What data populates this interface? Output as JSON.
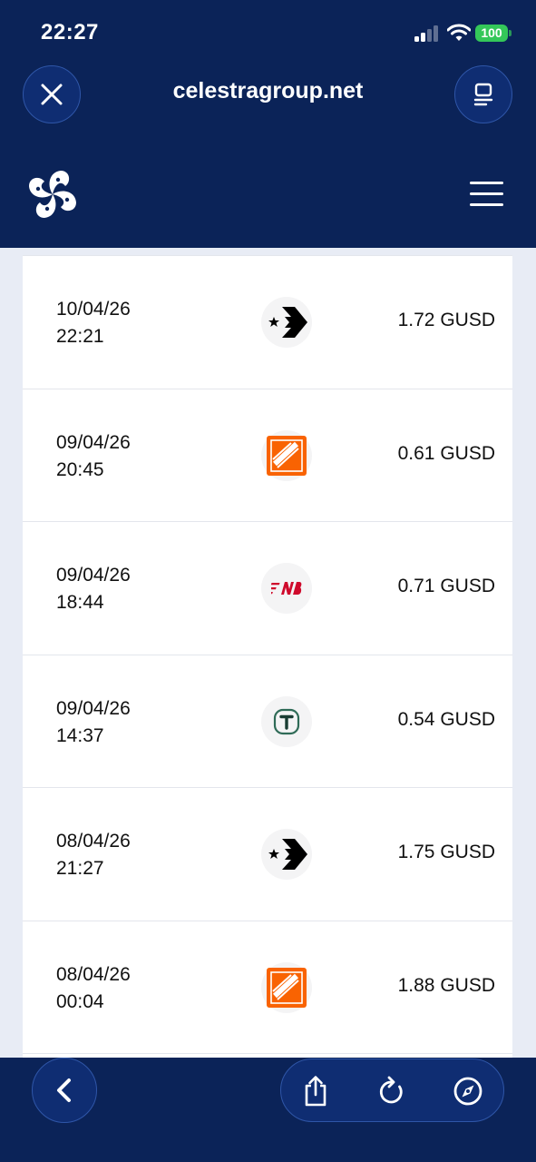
{
  "status_bar": {
    "time": "22:27",
    "battery": "100"
  },
  "browser": {
    "url": "celestragroup.net"
  },
  "transactions": [
    {
      "date": "10/04/26",
      "time": "22:21",
      "merchant_icon": "converse-logo-icon",
      "amount": "1.72 GUSD"
    },
    {
      "date": "09/04/26",
      "time": "20:45",
      "merchant_icon": "home-depot-logo-icon",
      "amount": "0.61 GUSD"
    },
    {
      "date": "09/04/26",
      "time": "18:44",
      "merchant_icon": "new-balance-logo-icon",
      "amount": "0.71 GUSD"
    },
    {
      "date": "09/04/26",
      "time": "14:37",
      "merchant_icon": "t-logo-icon",
      "amount": "0.54 GUSD"
    },
    {
      "date": "08/04/26",
      "time": "21:27",
      "merchant_icon": "converse-logo-icon",
      "amount": "1.75 GUSD"
    },
    {
      "date": "08/04/26",
      "time": "00:04",
      "merchant_icon": "home-depot-logo-icon",
      "amount": "1.88 GUSD"
    }
  ],
  "colors": {
    "header_bg": "#0b2358",
    "content_bg": "#e8ecf5",
    "home_depot_orange": "#f96302",
    "new_balance_red": "#cf0a2c",
    "t_logo_green": "#2f6b57"
  }
}
